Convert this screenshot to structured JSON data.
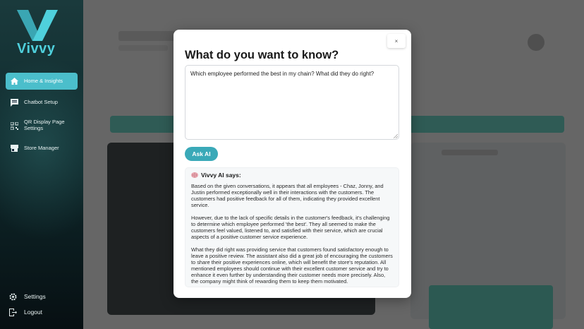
{
  "brand": {
    "name": "Vivvy",
    "color": "#4fd0dc"
  },
  "sidebar": {
    "items": [
      {
        "label": "Home & Insights",
        "icon": "home-icon",
        "active": true
      },
      {
        "label": "Chatbot Setup",
        "icon": "chat-icon",
        "active": false
      },
      {
        "label": "QR Display Page Settings",
        "icon": "qr-code-icon",
        "active": false
      },
      {
        "label": "Store Manager",
        "icon": "store-icon",
        "active": false
      }
    ],
    "bottom": [
      {
        "label": "Settings",
        "icon": "gear-icon"
      },
      {
        "label": "Logout",
        "icon": "logout-icon"
      }
    ],
    "active_color": "#4bbecb"
  },
  "modal": {
    "close_label": "×",
    "title": "What do you want to know?",
    "question_value": "Which employee performed the best in my chain? What did they do right?",
    "ask_label": "Ask AI",
    "ask_color": "#3aa9b8",
    "answer": {
      "heading": "Vivvy AI says:",
      "heading_icon": "brain-icon",
      "paragraphs": [
        "Based on the given conversations, it appears that all employees - Chaz, Jonny, and Justin performed exceptionally well in their interactions with the customers. The customers had positive feedback for all of them, indicating they provided excellent service.",
        "However, due to the lack of specific details in the customer's feedback, it's challenging to determine which employee performed 'the best'. They all seemed to make the customers feel valued, listened to, and satisfied with their service, which are crucial aspects of a positive customer service experience.",
        "What they did right was providing service that customers found satisfactory enough to leave a positive review. The assistant also did a great job of encouraging the customers to share their positive experiences online, which will benefit the store's reputation. All mentioned employees should continue with their excellent customer service and try to enhance it even further by understanding their customer needs more precisely. Also, the company might think of rewarding them to keep them motivated."
      ]
    }
  }
}
